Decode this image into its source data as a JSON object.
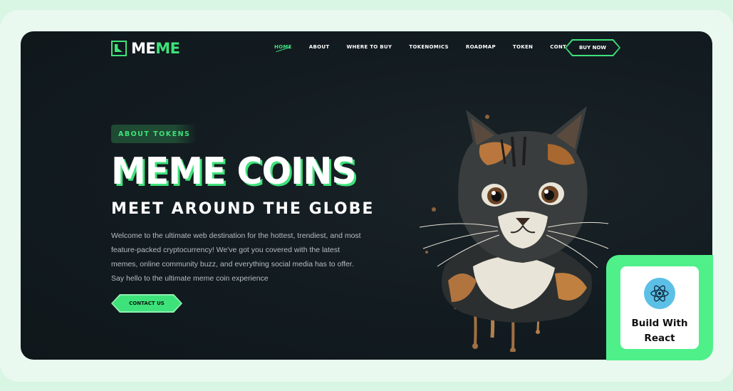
{
  "logo": {
    "text_white": "ME",
    "text_green": "ME"
  },
  "nav": {
    "items": [
      {
        "label": "HOME",
        "active": true
      },
      {
        "label": "ABOUT"
      },
      {
        "label": "WHERE TO BUY"
      },
      {
        "label": "TOKENOMICS"
      },
      {
        "label": "ROADMAP"
      },
      {
        "label": "TOKEN"
      },
      {
        "label": "CONTACT"
      }
    ],
    "buy_button": "BUY NOW"
  },
  "hero": {
    "badge": "ABOUT TOKENS",
    "title": "MEME COINS",
    "subtitle": "MEET AROUND THE GLOBE",
    "description": "Welcome to the ultimate web destination for the hottest, trendiest, and most feature-packed cryptocurrency! We've got you covered with the latest memes, online community buzz, and everything social media has to offer. Say hello to the ultimate meme coin experience",
    "cta": "CONTACT US"
  },
  "react_card": {
    "line1": "Build With",
    "line2": "React"
  },
  "colors": {
    "accent": "#3ee27a",
    "hero_bg": "#121b20",
    "page_bg": "#d9f5e3",
    "react_blue": "#5cc0e6"
  },
  "icons": [
    "logo-mark-icon",
    "react-atom-icon",
    "cat-illustration"
  ]
}
